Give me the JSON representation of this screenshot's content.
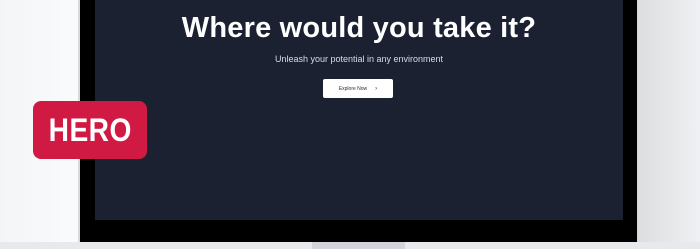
{
  "hero": {
    "headline": "Where would you take it?",
    "subheadline": "Unleash your potential in any environment",
    "cta_label": "Explore Now",
    "cta_icon": "chevron-right-icon"
  },
  "badge": {
    "label": "HERO",
    "color": "#d11a43"
  },
  "colors": {
    "screen_background": "#1c2132",
    "bezel": "#000000",
    "headline_text": "#ffffff"
  }
}
